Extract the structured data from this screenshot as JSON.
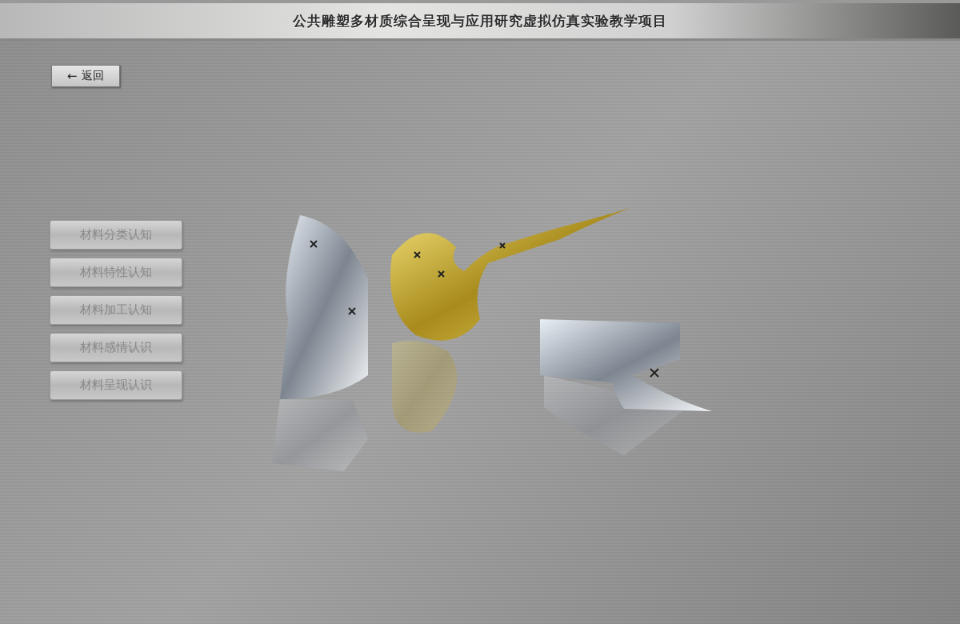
{
  "header": {
    "title": "公共雕塑多材质综合呈现与应用研究虚拟仿真实验教学项目"
  },
  "back_button": {
    "icon": "←",
    "label": "返回"
  },
  "menu": [
    {
      "label": "材料分类认知"
    },
    {
      "label": "材料特性认知"
    },
    {
      "label": "材料加工认知"
    },
    {
      "label": "材料感情认识"
    },
    {
      "label": "材料呈现认识"
    }
  ]
}
